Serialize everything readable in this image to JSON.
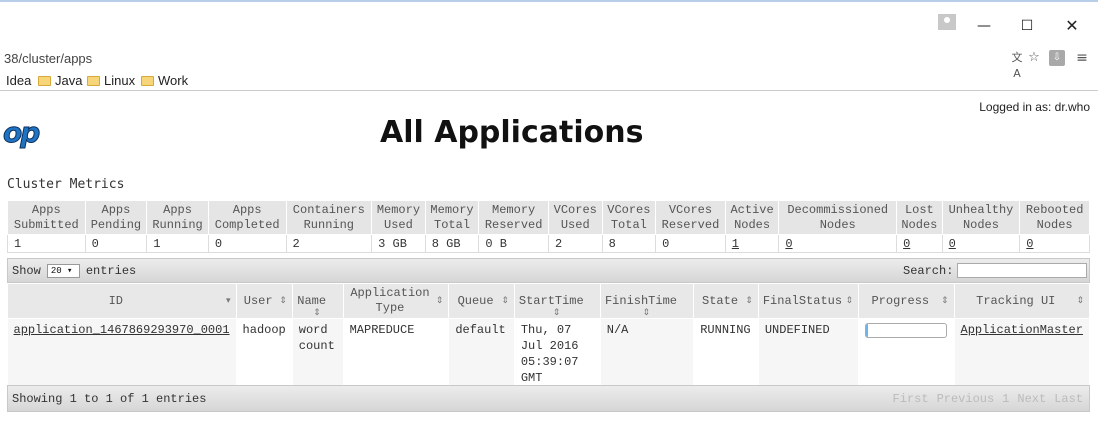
{
  "window": {
    "minimize_glyph": "—",
    "maximize_glyph": "☐",
    "close_glyph": "✕"
  },
  "browser": {
    "url": "38/cluster/apps",
    "bookmarks": [
      "Idea",
      "Java",
      "Linux",
      "Work"
    ]
  },
  "page": {
    "logged_in": "Logged in as: dr.who",
    "logo_text": "op",
    "title": "All Applications"
  },
  "cluster_metrics": {
    "title": "Cluster Metrics",
    "headers": [
      [
        "Apps",
        "Submitted"
      ],
      [
        "Apps",
        "Pending"
      ],
      [
        "Apps",
        "Running"
      ],
      [
        "Apps",
        "Completed"
      ],
      [
        "Containers",
        "Running"
      ],
      [
        "Memory",
        "Used"
      ],
      [
        "Memory",
        "Total"
      ],
      [
        "Memory",
        "Reserved"
      ],
      [
        "VCores",
        "Used"
      ],
      [
        "VCores",
        "Total"
      ],
      [
        "VCores",
        "Reserved"
      ],
      [
        "Active",
        "Nodes"
      ],
      [
        "Decommissioned",
        "Nodes"
      ],
      [
        "Lost",
        "Nodes"
      ],
      [
        "Unhealthy",
        "Nodes"
      ],
      [
        "Rebooted",
        "Nodes"
      ]
    ],
    "values": [
      "1",
      "0",
      "1",
      "0",
      "2",
      "3 GB",
      "8 GB",
      "0 B",
      "2",
      "8",
      "0",
      "1",
      "0",
      "0",
      "0",
      "0"
    ],
    "link_columns": [
      11,
      12,
      13,
      14,
      15
    ]
  },
  "apps_table": {
    "show_label": "Show",
    "entries_label": "entries",
    "page_length": "20 ▾",
    "search_label": "Search:",
    "search_value": "",
    "headers": [
      [
        "ID"
      ],
      [
        "User"
      ],
      [
        "Name"
      ],
      [
        "Application",
        "Type"
      ],
      [
        "Queue"
      ],
      [
        "StartTime"
      ],
      [
        "FinishTime"
      ],
      [
        "State"
      ],
      [
        "FinalStatus"
      ],
      [
        "Progress"
      ],
      [
        "Tracking UI"
      ]
    ],
    "rows": [
      {
        "id": "application_1467869293970_0001",
        "user": "hadoop",
        "name": [
          "word",
          "count"
        ],
        "type": "MAPREDUCE",
        "queue": "default",
        "start_time": [
          "Thu, 07",
          "Jul 2016",
          "05:39:07",
          "GMT"
        ],
        "finish_time": "N/A",
        "state": "RUNNING",
        "final_status": "UNDEFINED",
        "progress": 0.02,
        "tracking_ui": "ApplicationMaster"
      }
    ],
    "info": "Showing 1 to 1 of 1 entries",
    "pager": [
      "First",
      "Previous",
      "1",
      "Next",
      "Last"
    ]
  }
}
